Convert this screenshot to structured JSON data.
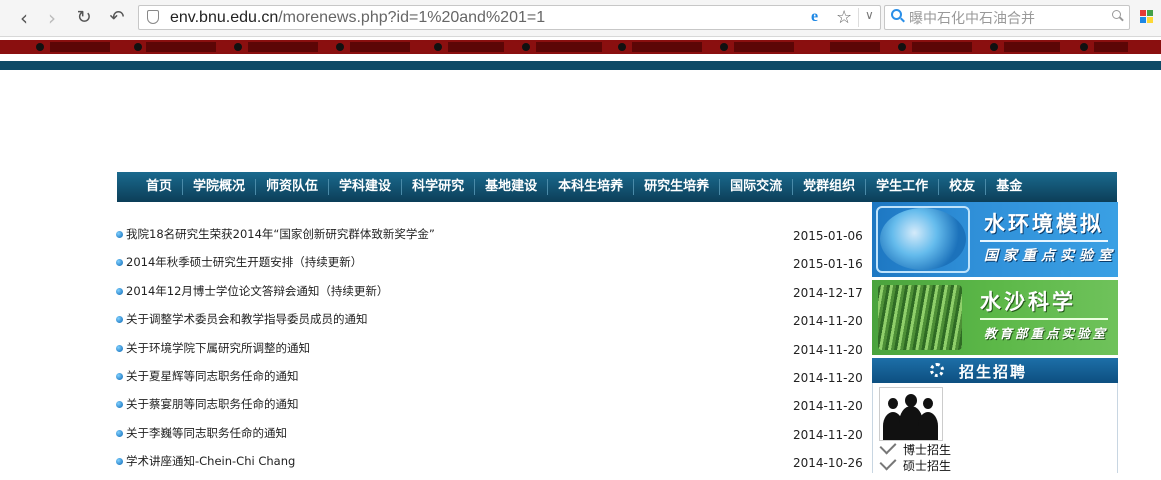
{
  "browser": {
    "url_host": "env.bnu.edu.cn",
    "url_path": "/morenews.php?id=1%20and%201=1",
    "search_text": "曝中石化中石油合并"
  },
  "nav": {
    "items": [
      "首页",
      "学院概况",
      "师资队伍",
      "学科建设",
      "科学研究",
      "基地建设",
      "本科生培养",
      "研究生培养",
      "国际交流",
      "党群组织",
      "学生工作",
      "校友",
      "基金"
    ]
  },
  "news": [
    {
      "title": "我院18名研究生荣获2014年“国家创新研究群体致新奖学金”",
      "date": "2015-01-06"
    },
    {
      "title": "2014年秋季硕士研究生开题安排（持续更新）",
      "date": "2015-01-16"
    },
    {
      "title": "2014年12月博士学位论文答辩会通知（持续更新）",
      "date": "2014-12-17"
    },
    {
      "title": "关于调整学术委员会和教学指导委员成员的通知",
      "date": "2014-11-20"
    },
    {
      "title": "关于环境学院下属研究所调整的通知",
      "date": "2014-11-20"
    },
    {
      "title": "关于夏星辉等同志职务任命的通知",
      "date": "2014-11-20"
    },
    {
      "title": "关于蔡宴朋等同志职务任命的通知",
      "date": "2014-11-20"
    },
    {
      "title": "关于李巍等同志职务任命的通知",
      "date": "2014-11-20"
    },
    {
      "title": "学术讲座通知-Chein-Chi Chang",
      "date": "2014-10-26"
    }
  ],
  "sidebar": {
    "banner1": {
      "title": "水环境模拟",
      "subtitle": "国家重点实验室"
    },
    "banner2": {
      "title": "水沙科学",
      "subtitle": "教育部重点实验室"
    },
    "recruit": {
      "title": "招生招聘",
      "links": [
        "博士招生",
        "硕士招生"
      ]
    }
  }
}
